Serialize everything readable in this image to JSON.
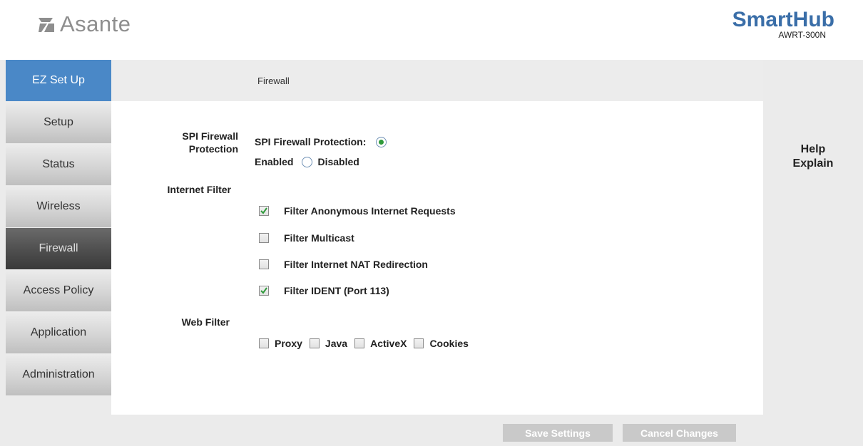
{
  "brand": {
    "name": "Asante"
  },
  "product": {
    "name": "SmartHub",
    "model": "AWRT-300N"
  },
  "nav": {
    "items": [
      {
        "label": "EZ Set Up"
      },
      {
        "label": "Setup"
      },
      {
        "label": "Status"
      },
      {
        "label": "Wireless"
      },
      {
        "label": "Firewall"
      },
      {
        "label": "Access Policy"
      },
      {
        "label": "Application"
      },
      {
        "label": "Administration"
      }
    ],
    "active": "Firewall"
  },
  "page": {
    "title": "Firewall"
  },
  "spi": {
    "section_label": "SPI Firewall Protection",
    "field_label": "SPI Firewall Protection:",
    "enabled_label": "Enabled",
    "disabled_label": "Disabled",
    "selected": "Enabled"
  },
  "internet_filter": {
    "section_label": "Internet Filter",
    "options": [
      {
        "label": "Filter Anonymous Internet Requests",
        "checked": true
      },
      {
        "label": "Filter Multicast",
        "checked": false
      },
      {
        "label": "Filter Internet NAT Redirection",
        "checked": false
      },
      {
        "label": "Filter IDENT (Port 113)",
        "checked": true
      }
    ]
  },
  "web_filter": {
    "section_label": "Web Filter",
    "options": [
      {
        "label": "Proxy",
        "checked": false
      },
      {
        "label": "Java",
        "checked": false
      },
      {
        "label": "ActiveX",
        "checked": false
      },
      {
        "label": "Cookies",
        "checked": false
      }
    ]
  },
  "help": {
    "line1": "Help",
    "line2": "Explain"
  },
  "buttons": {
    "save": "Save Settings",
    "cancel": "Cancel Changes"
  },
  "colors": {
    "accent": "#4a88c7",
    "brand": "#3a6ea8",
    "check": "#2e9a3a",
    "button": "#c9c9c9"
  }
}
